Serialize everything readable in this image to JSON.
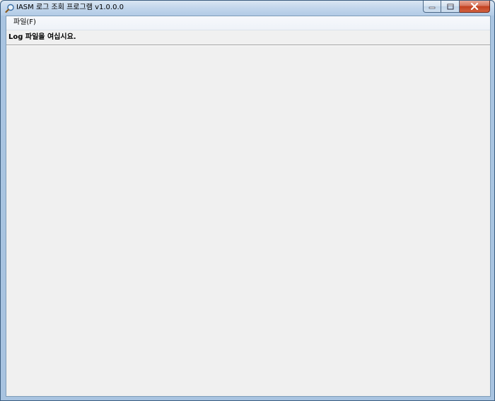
{
  "window": {
    "title": "IASM 로그 조회 프로그램 v1.0.0.0"
  },
  "menu": {
    "items": [
      {
        "label": "파일(F)"
      }
    ]
  },
  "status": {
    "message": "Log 파일을 여십시요."
  },
  "icons": {
    "app": "magnifier-icon",
    "minimize": "minimize-icon",
    "maximize": "maximize-icon",
    "close": "close-icon"
  },
  "colors": {
    "close_button": "#c2401f",
    "frame": "#a8c3e0",
    "client_bg": "#f0f0f0"
  }
}
